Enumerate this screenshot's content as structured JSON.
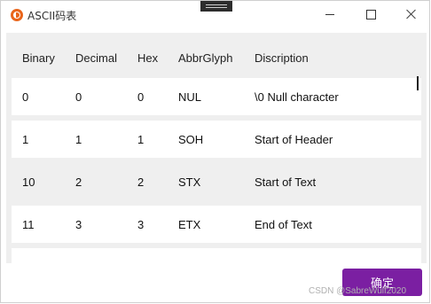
{
  "window": {
    "title": "ASCII码表",
    "icons": {
      "app": "app-logo-icon",
      "minimize": "minimize-icon",
      "maximize": "maximize-icon",
      "close": "close-icon"
    }
  },
  "table": {
    "columns": [
      "Binary",
      "Decimal",
      "Hex",
      "AbbrGlyph",
      "Discription"
    ],
    "rows": [
      [
        "0",
        "0",
        "0",
        "NUL",
        "\\0 Null character"
      ],
      [
        "1",
        "1",
        "1",
        "SOH",
        "Start of Header"
      ],
      [
        "10",
        "2",
        "2",
        "STX",
        "Start of Text"
      ],
      [
        "11",
        "3",
        "3",
        "ETX",
        "End of Text"
      ]
    ]
  },
  "footer": {
    "ok_label": "确定",
    "accent": "#7b1fa2",
    "watermark": "CSDN @SabreWulf2020"
  }
}
